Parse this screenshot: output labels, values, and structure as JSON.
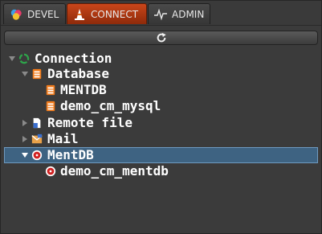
{
  "tabs": [
    {
      "label": "DEVEL",
      "icon": "devel-circles-icon",
      "active": false
    },
    {
      "label": "CONNECT",
      "icon": "cone-icon",
      "active": true
    },
    {
      "label": "ADMIN",
      "icon": "pulse-icon",
      "active": false
    }
  ],
  "toolbar": {
    "refresh_icon": "refresh-icon"
  },
  "tree": {
    "connection": "Connection",
    "database": "Database",
    "mentdb_db": "MENTDB",
    "demo_cm_mysql": "demo_cm_mysql",
    "remote_file": "Remote file",
    "mail": "Mail",
    "mentdb": "MentDB",
    "demo_cm_mentdb": "demo_cm_mentdb"
  },
  "colors": {
    "accent_tab": "#b23c12",
    "selection": "#3e6382",
    "db_icon": "#f07a1a",
    "mentdb_icon": "#d02020"
  }
}
